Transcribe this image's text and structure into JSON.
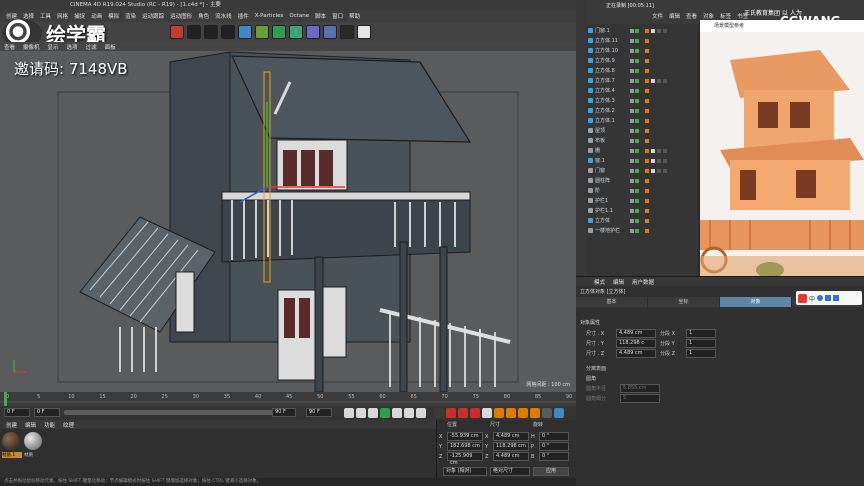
{
  "window": {
    "title": "CINEMA 4D R19.024 Studio (RC - R19) - [1.c4d *] - 主要"
  },
  "brand": {
    "text": "绘学霸"
  },
  "menu": [
    "创建",
    "选择",
    "工具",
    "网格",
    "捕捉",
    "动画",
    "模拟",
    "渲染",
    "运动跟踪",
    "运动图形",
    "角色",
    "流水线",
    "插件",
    "X-Particles",
    "Octane",
    "脚本",
    "窗口",
    "帮助"
  ],
  "promo": {
    "text": "邀请码: 7148VB"
  },
  "viewport": {
    "menu": [
      "查看",
      "摄像机",
      "显示",
      "选项",
      "过滤",
      "面板"
    ],
    "grid_info": "网格间距 : 100 cm"
  },
  "timeline": {
    "ticks": [
      "0",
      "5",
      "10",
      "15",
      "20",
      "25",
      "30",
      "35",
      "40",
      "45",
      "50",
      "55",
      "60",
      "65",
      "70",
      "75",
      "80",
      "85",
      "90"
    ],
    "current": "0 F",
    "start": "0 F",
    "end": "90 F",
    "end2": "90 F"
  },
  "material": {
    "menu": [
      "创建",
      "编辑",
      "功能",
      "纹理"
    ],
    "items": [
      "材质.1",
      "材质"
    ]
  },
  "coords": {
    "headers": [
      "位置",
      "尺寸",
      "旋转"
    ],
    "rows": [
      {
        "axis": "X",
        "pos": "-55.939 cm",
        "size_axis": "X",
        "size": "4.489 cm",
        "rot_axis": "H",
        "rot": "0 °"
      },
      {
        "axis": "Y",
        "pos": "182.698 cm",
        "size_axis": "Y",
        "size": "118.298 cm",
        "rot_axis": "P",
        "rot": "0 °"
      },
      {
        "axis": "Z",
        "pos": "-125.909 cm",
        "size_axis": "Z",
        "size": "4.489 cm",
        "rot_axis": "B",
        "rot": "0 °"
      }
    ],
    "mode": "对象 (相对)",
    "size_mode": "绝对尺寸",
    "apply": "应用"
  },
  "statusbar": {
    "text": "点击并拖动鼠标移动元素。按住 SHIFT 键量化移动；节点编辑模式时按住 SHIFT 键增加选择对象；按住 CTRL 键减少选择对象。"
  },
  "objects": {
    "tabs": [
      "文件",
      "编辑",
      "查看",
      "对象",
      "标签",
      "书签"
    ],
    "rows": [
      {
        "label": "门窗.1",
        "color": "#3aa3e0",
        "tags": true
      },
      {
        "label": "立方体.11",
        "color": "#3aa3e0",
        "tags": false
      },
      {
        "label": "立方体.10",
        "color": "#3aa3e0",
        "tags": false
      },
      {
        "label": "立方体.9",
        "color": "#3aa3e0",
        "tags": false
      },
      {
        "label": "立方体.8",
        "color": "#3aa3e0",
        "tags": false
      },
      {
        "label": "立方体.7",
        "color": "#3aa3e0",
        "tags": true
      },
      {
        "label": "立方体.4",
        "color": "#3aa3e0",
        "tags": false
      },
      {
        "label": "立方体.3",
        "color": "#3aa3e0",
        "tags": false
      },
      {
        "label": "立方体.2",
        "color": "#3aa3e0",
        "tags": false
      },
      {
        "label": "立方体.1",
        "color": "#3aa3e0",
        "tags": false
      },
      {
        "label": "屋顶",
        "color": "#9aa0a6",
        "tags": false
      },
      {
        "label": "布板",
        "color": "#9aa0a6",
        "tags": false
      },
      {
        "label": "栅",
        "color": "#9aa0a6",
        "tags": true
      },
      {
        "label": "窗.1",
        "color": "#3aa3e0",
        "tags": true
      },
      {
        "label": "门窗",
        "color": "#9aa0a6",
        "tags": true
      },
      {
        "label": "圆柱阵",
        "color": "#9aa0a6",
        "tags": false
      },
      {
        "label": "阶",
        "color": "#9aa0a6",
        "tags": false
      },
      {
        "label": "护栏1",
        "color": "#9aa0a6",
        "tags": false
      },
      {
        "label": "护栏1.1",
        "color": "#9aa0a6",
        "tags": false
      },
      {
        "label": "立方体",
        "color": "#3aa3e0",
        "tags": false
      },
      {
        "label": "一楼地护栏",
        "color": "#9aa0a6",
        "tags": false
      }
    ]
  },
  "attributes": {
    "menu": [
      "模式",
      "编辑",
      "用户数据"
    ],
    "object_name": "立方体对象 [立方体]",
    "tabs": [
      "基本",
      "坐标",
      "对象",
      "平滑着色(Phong)"
    ],
    "active_tab": 2,
    "section": "对象属性",
    "rows": [
      {
        "label": "尺寸 . X",
        "value": "4.489 cm",
        "seg_label": "分段 X",
        "seg": "1"
      },
      {
        "label": "尺寸 . Y",
        "value": "118.298 c",
        "seg_label": "分段 Y",
        "seg": "1"
      },
      {
        "label": "尺寸 . Z",
        "value": "4.489 cm",
        "seg_label": "分段 Z",
        "seg": "1"
      }
    ],
    "extra": [
      "分离表面",
      "圆角",
      "圆角半径",
      "圆角细分"
    ],
    "fillet_radius": "5.855 cm",
    "fillet_sub": "5"
  },
  "recorder": {
    "text": "正在录制 [00:05:11]"
  },
  "preview": {
    "caption": "场景模型参考"
  },
  "watermark": {
    "line1": "王氏教育集团 以 人为",
    "line2": "CGWANG"
  },
  "ime": {
    "label": "中"
  }
}
